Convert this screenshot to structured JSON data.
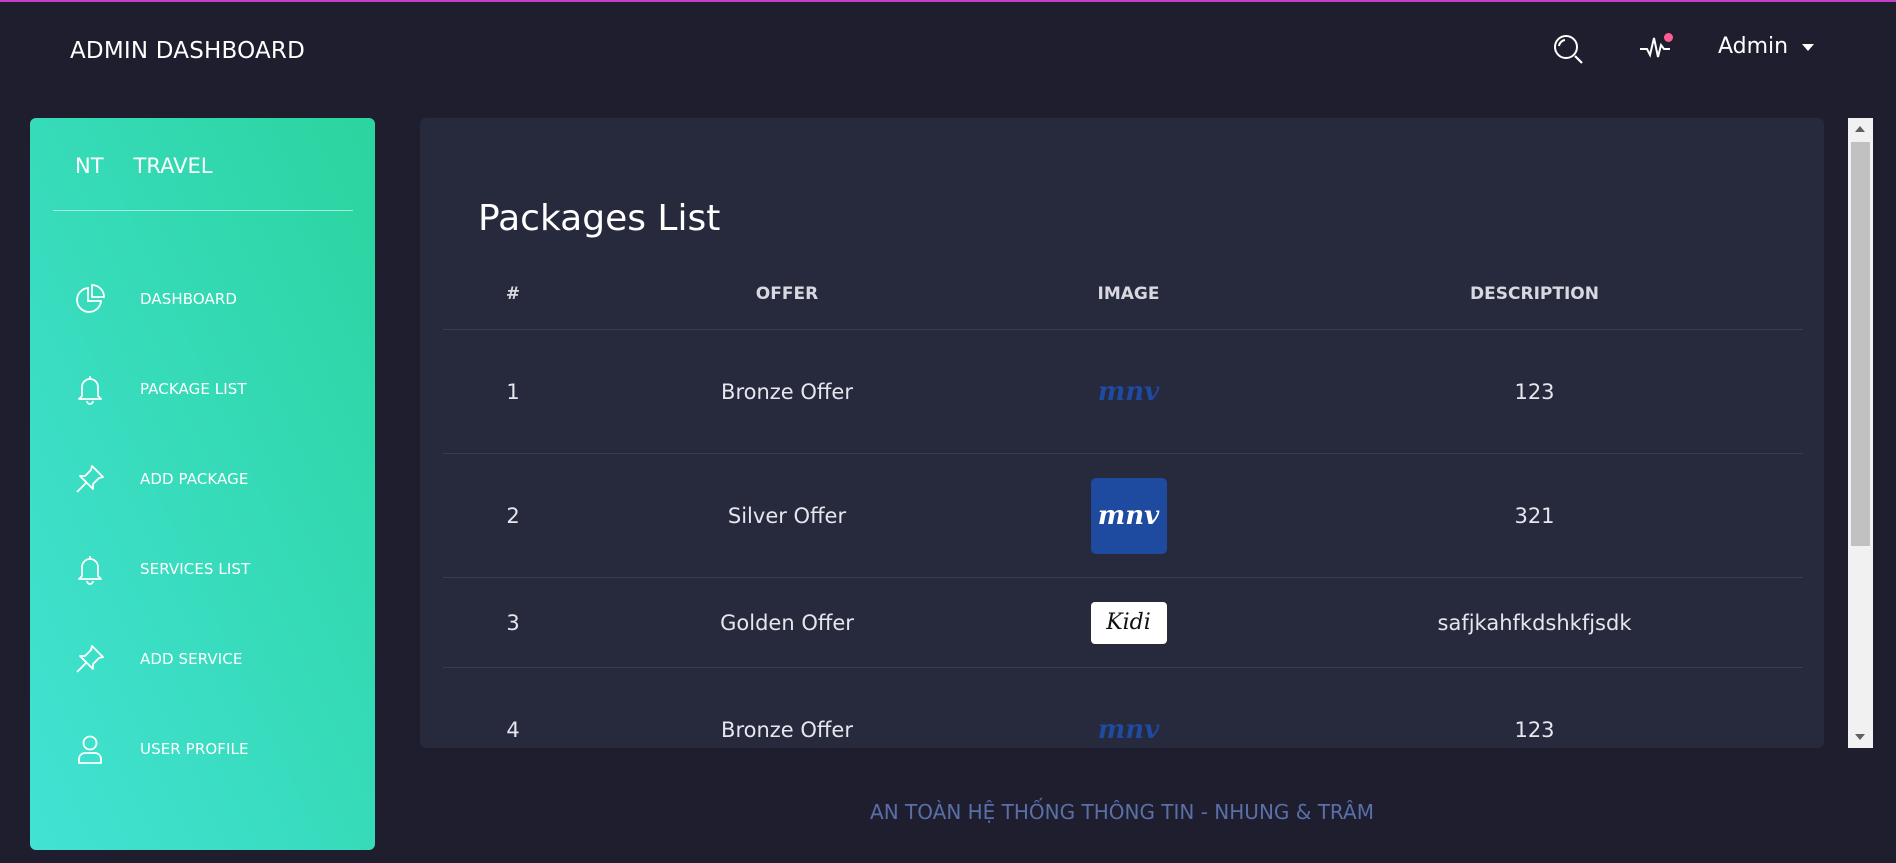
{
  "header": {
    "brand": "ADMIN DASHBOARD",
    "user_name": "Admin",
    "icons": {
      "search": "search-icon",
      "activity": "activity-icon"
    },
    "notification_color": "#fd5d93"
  },
  "sidebar": {
    "logo": {
      "short": "NT",
      "name": "TRAVEL"
    },
    "gradient": [
      "#42e2d4",
      "#2bd49f"
    ],
    "items": [
      {
        "label": "DASHBOARD",
        "icon": "pie-chart-icon"
      },
      {
        "label": "PACKAGE LIST",
        "icon": "bell-icon"
      },
      {
        "label": "ADD PACKAGE",
        "icon": "pin-icon"
      },
      {
        "label": "SERVICES LIST",
        "icon": "bell-icon"
      },
      {
        "label": "ADD SERVICE",
        "icon": "pin-icon"
      },
      {
        "label": "USER PROFILE",
        "icon": "user-icon"
      }
    ]
  },
  "main": {
    "title": "Packages List",
    "columns": [
      "#",
      "OFFER",
      "IMAGE",
      "DESCRIPTION"
    ],
    "rows": [
      {
        "id": "1",
        "offer": "Bronze Offer",
        "image_text": "mnv",
        "description": "123"
      },
      {
        "id": "2",
        "offer": "Silver Offer",
        "image_text": "mnv",
        "description": "321"
      },
      {
        "id": "3",
        "offer": "Golden Offer",
        "image_text": "Kidi",
        "description": "safjkahfkdshkfjsdk"
      },
      {
        "id": "4",
        "offer": "Bronze Offer",
        "image_text": "mnv",
        "description": "123"
      }
    ]
  },
  "footer": {
    "text": "AN TOÀN HỆ THỐNG THÔNG TIN - NHUNG & TRÂM"
  }
}
